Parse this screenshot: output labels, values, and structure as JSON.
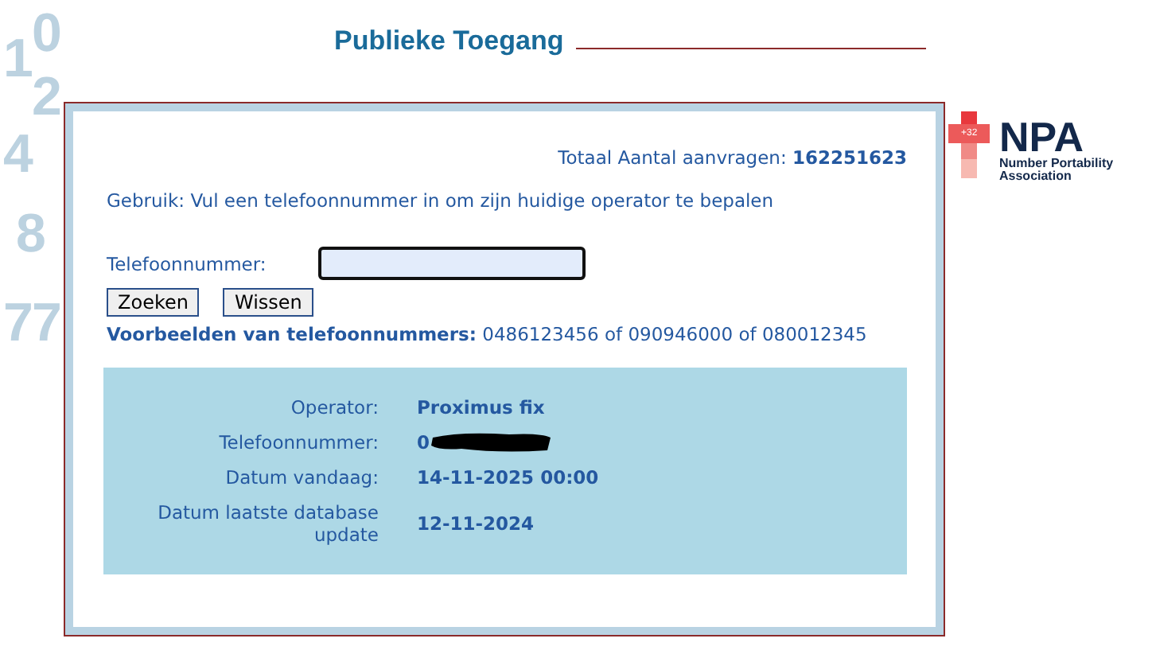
{
  "background_digits": [
    "1",
    "0",
    "2",
    "4",
    "8",
    "7",
    "7"
  ],
  "title": "Publieke Toegang",
  "logo": {
    "badge": "+32",
    "name": "NPA",
    "line_1": "Number Portability",
    "line_2": "Association"
  },
  "total": {
    "label": "Totaal Aantal aanvragen:",
    "value": "162251623"
  },
  "usage": "Gebruik: Vul een telefoonnummer in om zijn huidige operator te bepalen",
  "phone_field": {
    "label": "Telefoonnummer:"
  },
  "buttons": [
    "Zoeken",
    "Wissen"
  ],
  "examples": {
    "label": "Voorbeelden van telefoonnummers:",
    "text": "0486123456 of 090946000 of 080012345"
  },
  "result": [
    {
      "label": "Operator:",
      "value": "Proximus fix",
      "redacted": false
    },
    {
      "label": "Telefoonnummer:",
      "value": "0",
      "redacted": true
    },
    {
      "label": "Datum vandaag:",
      "value": "14-11-2025 00:00",
      "redacted": false
    },
    {
      "label": "Datum laatste database update",
      "value": "12-11-2024",
      "redacted": false
    }
  ]
}
